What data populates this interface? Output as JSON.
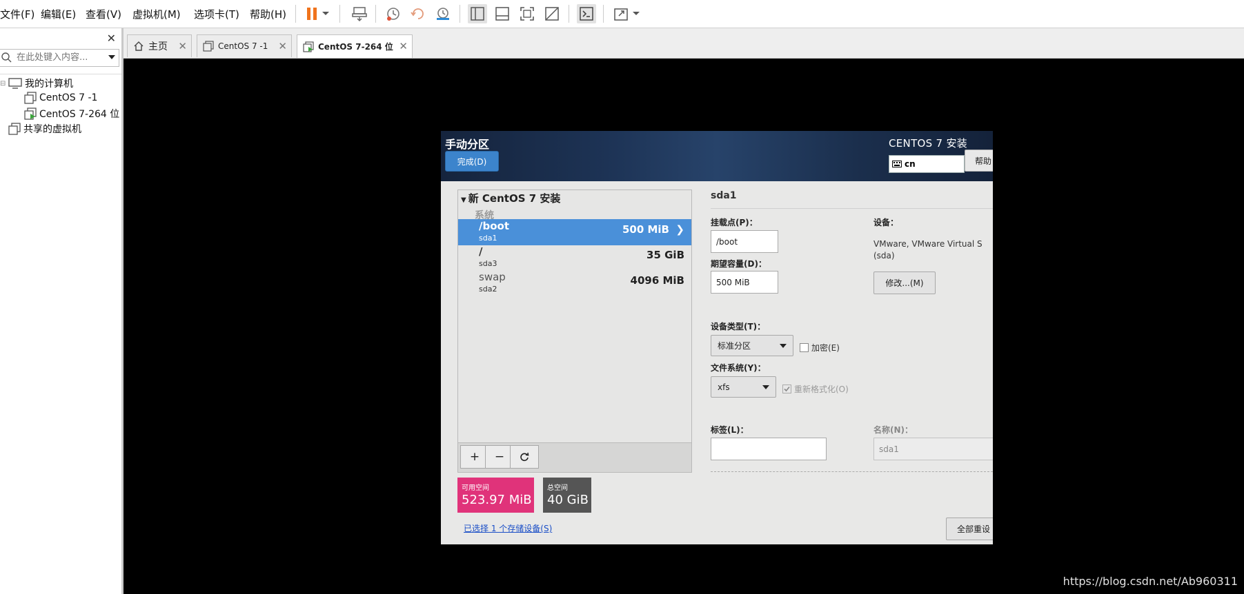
{
  "menu": {
    "items": [
      "文件(F)",
      "编辑(E)",
      "查看(V)",
      "虚拟机(M)",
      "选项卡(T)",
      "帮助(H)"
    ]
  },
  "toolbar": {
    "icons": [
      "pause-icon",
      "dropdown-arrow-icon",
      "send-ctrl-alt-del-icon",
      "snapshot-icon",
      "revert-snapshot-icon",
      "snapshot-manager-icon",
      "library-view-icon",
      "thumbnail-view-icon",
      "fullscreen-icon",
      "unity-icon",
      "console-icon",
      "stretch-icon"
    ]
  },
  "sidebar": {
    "search_placeholder": "在此处键入内容...",
    "tree": {
      "root": "我的计算机",
      "vms": [
        "CentOS 7 -1",
        "CentOS 7-264 位"
      ],
      "shared": "共享的虚拟机"
    }
  },
  "tabs": [
    {
      "label": "主页",
      "icon": "home-icon",
      "active": false
    },
    {
      "label": "CentOS 7 -1",
      "icon": "vm-icon",
      "active": false
    },
    {
      "label": "CentOS 7-264 位",
      "icon": "vm-running-icon",
      "active": true
    }
  ],
  "installer": {
    "title": "手动分区",
    "done_button": "完成(D)",
    "product": "CENTOS 7 安装",
    "keyboard": "cn",
    "help_button": "帮助",
    "install_group": "新 CentOS 7 安装",
    "system_label": "系统",
    "partitions": [
      {
        "mount": "/boot",
        "device": "sda1",
        "size": "500 MiB",
        "selected": true
      },
      {
        "mount": "/",
        "device": "sda3",
        "size": "35 GiB",
        "selected": false
      },
      {
        "mount": "swap",
        "device": "sda2",
        "size": "4096 MiB",
        "selected": false
      }
    ],
    "available_label": "可用空间",
    "available_value": "523.97 MiB",
    "total_label": "总空间",
    "total_value": "40 GiB",
    "storage_link": "已选择 1 个存储设备(S)",
    "details": {
      "title": "sda1",
      "mount_label": "挂载点(P)：",
      "mount_value": "/boot",
      "capacity_label": "期望容量(D)：",
      "capacity_value": "500 MiB",
      "device_label": "设备：",
      "device_desc": "VMware, VMware Virtual S (sda)",
      "modify_button": "修改...(M)",
      "device_type_label": "设备类型(T)：",
      "device_type_value": "标准分区",
      "encrypt_label": "加密(E)",
      "fs_label": "文件系统(Y)：",
      "fs_value": "xfs",
      "reformat_label": "重新格式化(O)",
      "tag_label": "标签(L)：",
      "tag_value": "",
      "name_label": "名称(N)：",
      "name_value": "sda1",
      "reset_button": "全部重设"
    }
  },
  "watermark": "https://blog.csdn.net/Ab960311"
}
